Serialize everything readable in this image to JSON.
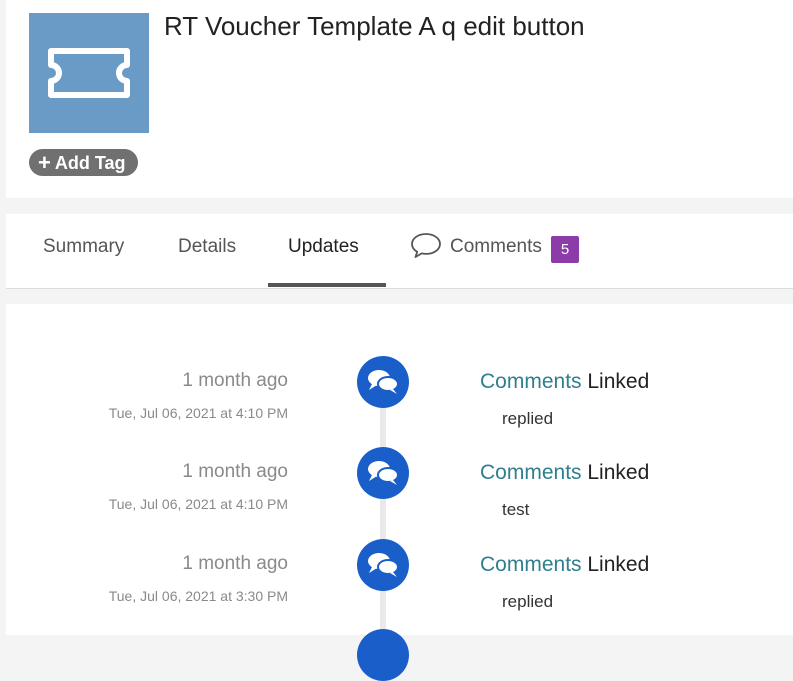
{
  "header": {
    "title": "RT Voucher Template A q edit button",
    "thumbnail_icon": "ticket-icon",
    "thumbnail_color": "#6a9bc6",
    "add_tag_label": "Add Tag"
  },
  "tabs": [
    {
      "label": "Summary",
      "active": false
    },
    {
      "label": "Details",
      "active": false
    },
    {
      "label": "Updates",
      "active": true
    },
    {
      "label": "Comments",
      "active": false,
      "icon": "speech-bubble-icon",
      "badge": "5"
    }
  ],
  "colors": {
    "accent_blue": "#1a5fc9",
    "link_teal": "#2f7f8f",
    "badge_purple": "#8d3ba8",
    "tag_gray": "#707070"
  },
  "updates": [
    {
      "relative_time": "1 month ago",
      "timestamp": "Tue, Jul 06, 2021 at 4:10 PM",
      "link": "Comments",
      "action": " Linked",
      "body": "replied",
      "icon": "chat-bubbles-icon"
    },
    {
      "relative_time": "1 month ago",
      "timestamp": "Tue, Jul 06, 2021 at 4:10 PM",
      "link": "Comments",
      "action": " Linked",
      "body": "test",
      "icon": "chat-bubbles-icon"
    },
    {
      "relative_time": "1 month ago",
      "timestamp": "Tue, Jul 06, 2021 at 3:30 PM",
      "link": "Comments",
      "action": " Linked",
      "body": "replied",
      "icon": "chat-bubbles-icon"
    }
  ]
}
